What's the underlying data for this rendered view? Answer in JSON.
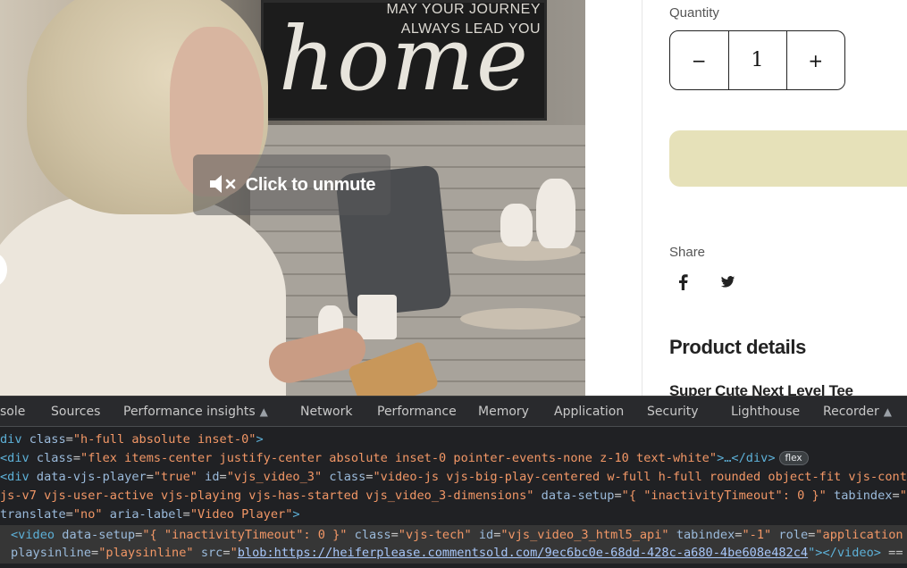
{
  "video": {
    "unmute_label": "Click to unmute",
    "sign_line1": "MAY YOUR JOURNEY",
    "sign_line2": "ALWAYS LEAD YOU",
    "sign_word": "home"
  },
  "product": {
    "quantity_label": "Quantity",
    "quantity_value": "1",
    "decrement_symbol": "−",
    "increment_symbol": "+",
    "share_label": "Share",
    "details_title": "Product details",
    "product_name": "Super Cute Next Level Tee",
    "cart_button_color": "#e6e1b9"
  },
  "devtools": {
    "tabs": [
      {
        "label": "sole"
      },
      {
        "label": "Sources"
      },
      {
        "label": "Performance insights",
        "experimental": true
      },
      {
        "label": "Network"
      },
      {
        "label": "Performance"
      },
      {
        "label": "Memory"
      },
      {
        "label": "Application"
      },
      {
        "label": "Security"
      },
      {
        "label": "Lighthouse"
      },
      {
        "label": "Recorder",
        "experimental": true
      }
    ],
    "lines": {
      "l1_tag_open": "div ",
      "l1_attr": "class",
      "l1_val": "\"h-full absolute inset-0\"",
      "l1_close": ">",
      "l2_tag_open": "<div ",
      "l2_attr": "class",
      "l2_val": "\"flex items-center justify-center absolute inset-0 pointer-events-none z-10 text-white\"",
      "l2_tail": ">…</div>",
      "l2_badge": "flex",
      "l3_tag_open": "<div ",
      "l3_attr1": "data-vjs-player",
      "l3_val1": "\"true\"",
      "l3_attr2": "id",
      "l3_val2": "\"vjs_video_3\"",
      "l3_attr3": "class",
      "l3_val3": "\"video-js vjs-big-play-centered w-full h-full rounded object-fit vjs-cont",
      "l4_val": "js-v7 vjs-user-active vjs-playing vjs-has-started vjs_video_3-dimensions\"",
      "l4_attr1": "data-setup",
      "l4_val1": "\"{ \"inactivityTimeout\": 0 }\"",
      "l4_attr2": "tabindex",
      "l4_val2": "\"",
      "l5_attr1": "translate",
      "l5_val1": "\"no\"",
      "l5_attr2": "aria-label",
      "l5_val2": "\"Video Player\"",
      "l5_close": ">",
      "l6_tag_open": "<video ",
      "l6_attr1": "data-setup",
      "l6_val1": "\"{ \"inactivityTimeout\": 0 }\"",
      "l6_attr2": "class",
      "l6_val2": "\"vjs-tech\"",
      "l6_attr3": "id",
      "l6_val3": "\"vjs_video_3_html5_api\"",
      "l6_attr4": "tabindex",
      "l6_val4": "\"-1\"",
      "l6_attr5": "role",
      "l6_val5": "\"application",
      "l7_attr1": "playsinline",
      "l7_val1": "\"playsinline\"",
      "l7_attr2": "src",
      "l7_link": "blob:https://heiferplease.commentsold.com/9ec6bc0e-68dd-428c-a680-4be608e482c4",
      "l7_tail": "\"></video>",
      "l7_end": " =="
    }
  }
}
